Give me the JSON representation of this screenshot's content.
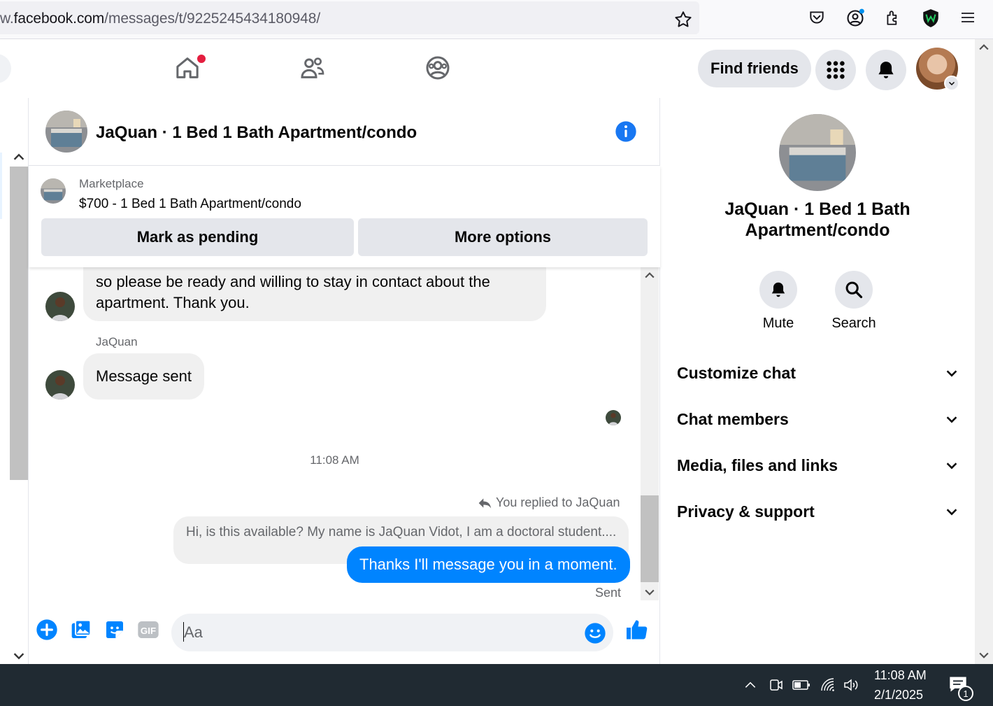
{
  "browser": {
    "url_prefix": "w.",
    "url_host": "facebook.com",
    "url_path": "/messages/t/9225245434180948/"
  },
  "header": {
    "find_friends_label": "Find friends"
  },
  "chat": {
    "title": "JaQuan · 1 Bed 1 Bath Apartment/condo",
    "marketplace": {
      "label": "Marketplace",
      "listing": "$700 - 1 Bed 1 Bath Apartment/condo",
      "mark_pending_label": "Mark as pending",
      "more_options_label": "More options"
    },
    "messages": {
      "incoming_1": "so please be ready and willing to stay in contact about the apartment. Thank you.",
      "sender_name": "JaQuan",
      "incoming_2": "Message sent",
      "timestamp": "11:08 AM",
      "replied_to": "You replied to JaQuan",
      "quoted": "Hi, is this available? My name is JaQuan Vidot, I am a doctoral student....",
      "outgoing": "Thanks I'll message you in a moment.",
      "status": "Sent"
    },
    "composer": {
      "placeholder": "Aa"
    }
  },
  "info_panel": {
    "name": "JaQuan · 1 Bed 1 Bath Apartment/condo",
    "actions": [
      {
        "label": "Mute",
        "icon": "bell-icon"
      },
      {
        "label": "Search",
        "icon": "search-icon"
      }
    ],
    "sections": [
      {
        "label": "Customize chat"
      },
      {
        "label": "Chat members"
      },
      {
        "label": "Media, files and links"
      },
      {
        "label": "Privacy & support"
      }
    ]
  },
  "taskbar": {
    "time": "11:08 AM",
    "date": "2/1/2025",
    "notification_count": "1"
  },
  "colors": {
    "messenger_blue": "#0084ff",
    "fb_blue": "#1877f2",
    "notification_red": "#e41e3f",
    "taskbar": "#202a32"
  }
}
